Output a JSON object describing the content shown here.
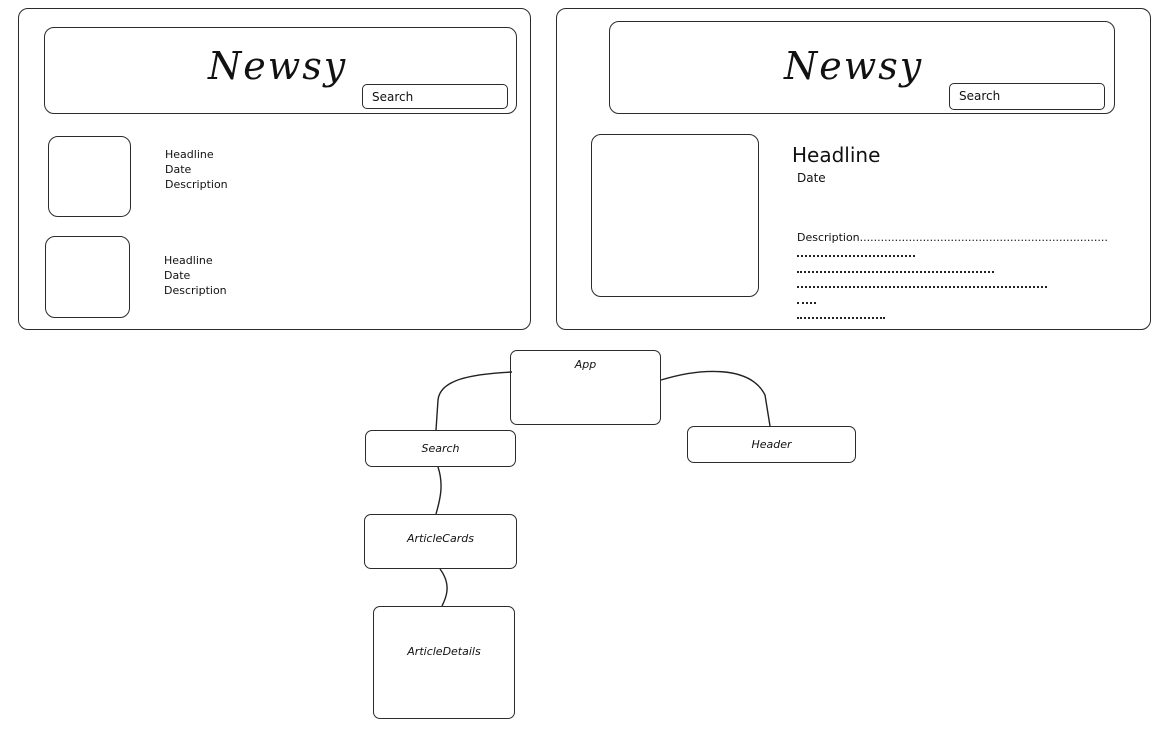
{
  "wireframe_list": {
    "logo": "Newsy",
    "search_label": "Search",
    "cards": [
      {
        "headline": "Headline",
        "date": "Date",
        "description": "Description"
      },
      {
        "headline": "Headline",
        "date": "Date",
        "description": "Description"
      }
    ]
  },
  "wireframe_detail": {
    "logo": "Newsy",
    "search_label": "Search",
    "headline": "Headline",
    "date": "Date",
    "description": "Description......................................................................."
  },
  "component_tree": {
    "nodes": {
      "app": "App",
      "search": "Search",
      "header": "Header",
      "article_cards": "ArticleCards",
      "article_details": "ArticleDetails"
    },
    "edges": [
      [
        "App",
        "Search"
      ],
      [
        "App",
        "Header"
      ],
      [
        "Search",
        "ArticleCards"
      ],
      [
        "ArticleCards",
        "ArticleDetails"
      ]
    ]
  }
}
